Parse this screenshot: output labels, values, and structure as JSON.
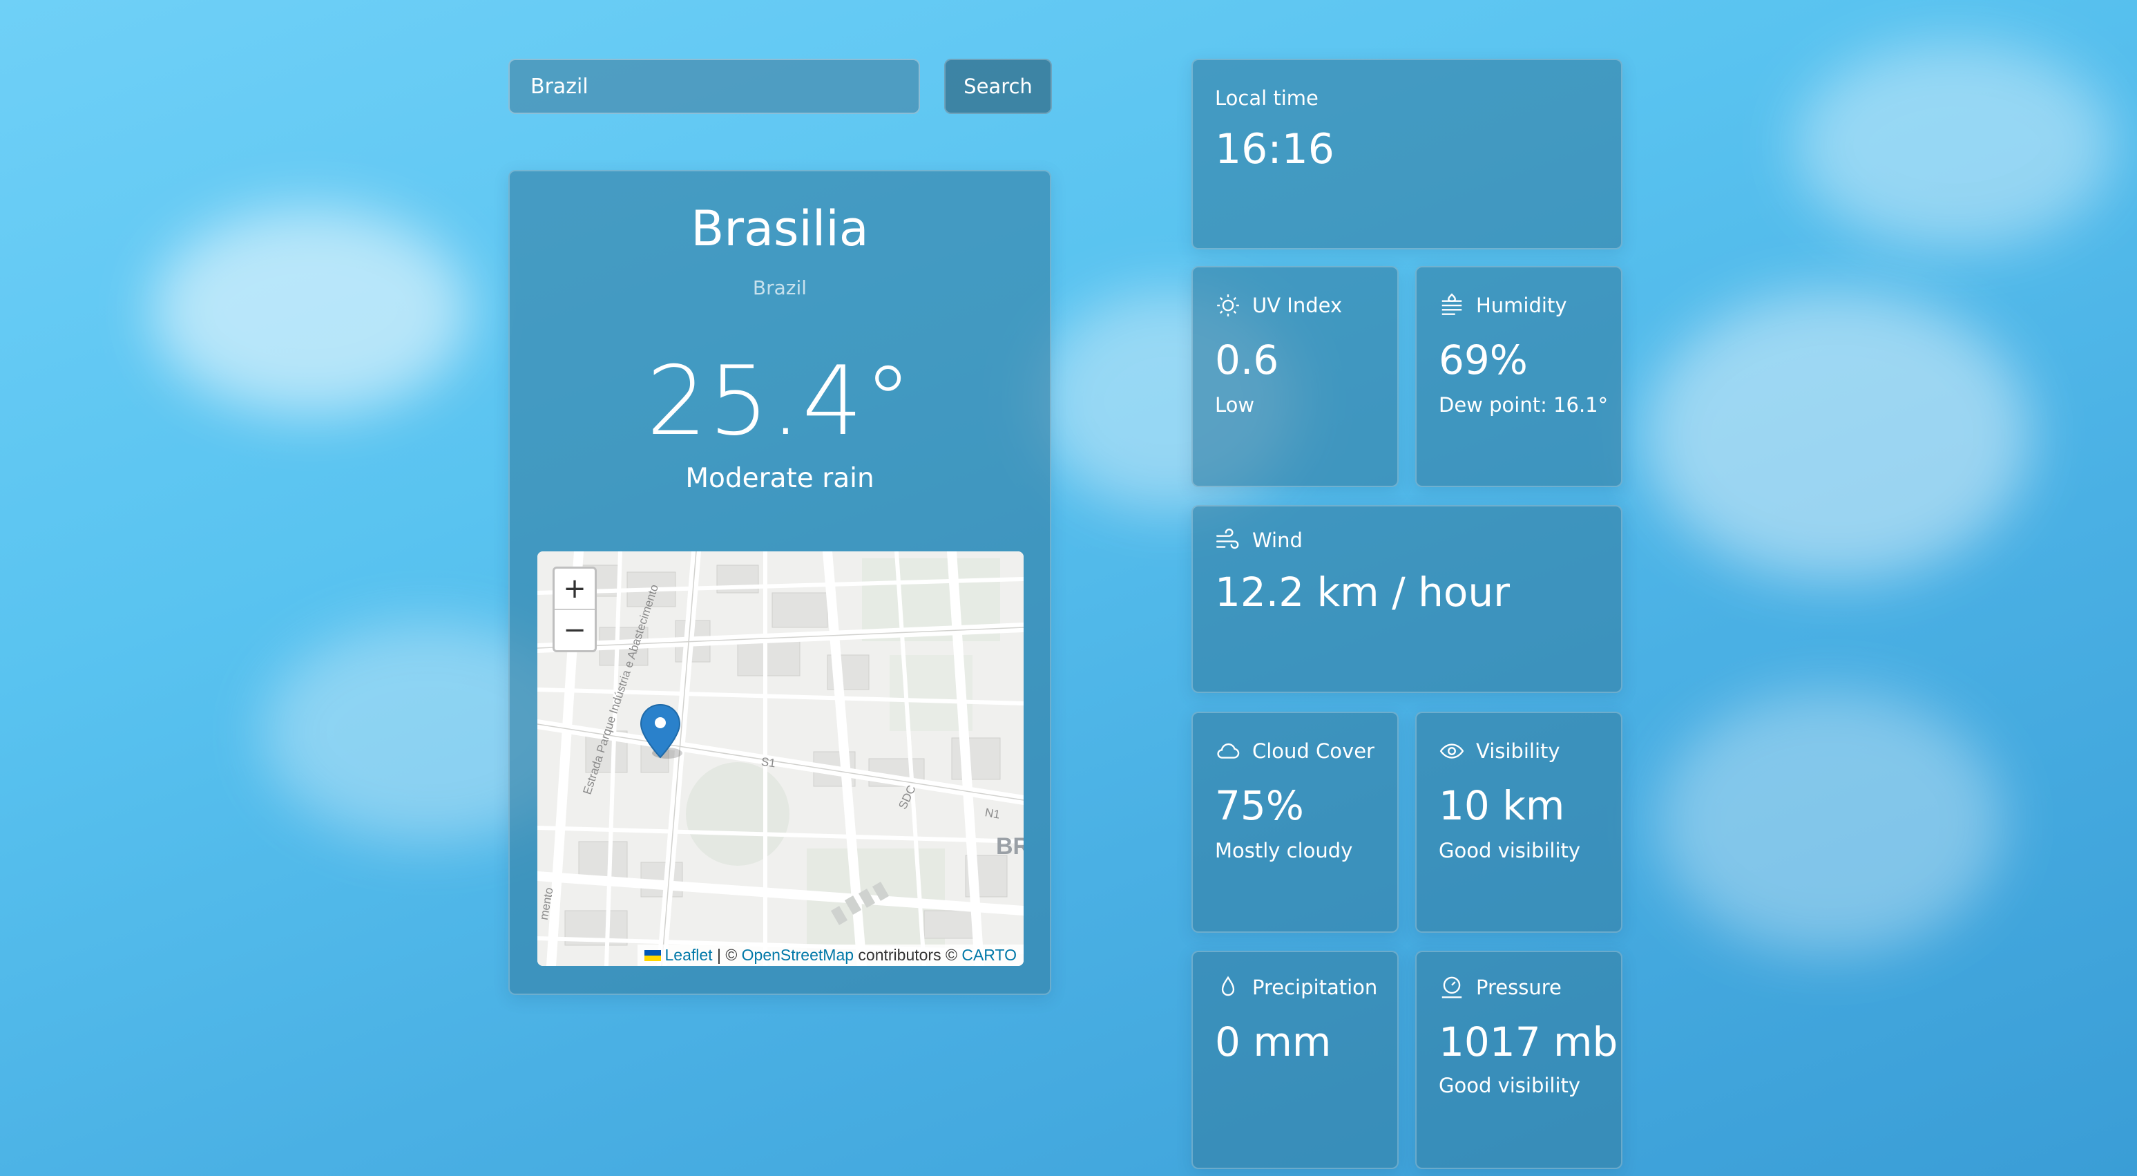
{
  "search": {
    "value": "Brazil",
    "button_label": "Search"
  },
  "location": {
    "city": "Brasilia",
    "country": "Brazil"
  },
  "current": {
    "temperature": "25.4°",
    "condition": "Moderate rain"
  },
  "map": {
    "zoom_in": "+",
    "zoom_out": "−",
    "attribution": {
      "leaflet": "Leaflet",
      "sep1": " | © ",
      "osm": "OpenStreetMap",
      "mid": " contributors © ",
      "carto": "CARTO"
    },
    "street_labels": [
      "Estrada Parque Indústria e Abastecimento",
      "S1",
      "SDC",
      "N1",
      "BR",
      "mento"
    ]
  },
  "local_time": {
    "label": "Local time",
    "value": "16:16"
  },
  "uv": {
    "label": "UV Index",
    "value": "0.6",
    "description": "Low",
    "icon": "sun-icon"
  },
  "humidity": {
    "label": "Humidity",
    "value": "69%",
    "description": "Dew point: 16.1°",
    "icon": "humidity-icon"
  },
  "wind": {
    "label": "Wind",
    "value": "12.2 km / hour",
    "icon": "wind-icon"
  },
  "cloud_cover": {
    "label": "Cloud Cover",
    "value": "75%",
    "description": "Mostly cloudy",
    "icon": "cloud-icon"
  },
  "visibility": {
    "label": "Visibility",
    "value": "10 km",
    "description": "Good visibility",
    "icon": "eye-icon"
  },
  "precipitation": {
    "label": "Precipitation",
    "value": "0 mm",
    "icon": "droplet-icon"
  },
  "pressure": {
    "label": "Pressure",
    "value": "1017 mb",
    "description": "Good visibility",
    "icon": "gauge-icon"
  },
  "colors": {
    "accent": "#4a9fd0",
    "card": "#3480a5",
    "map_link": "#0078a8",
    "marker": "#2a81cb"
  }
}
